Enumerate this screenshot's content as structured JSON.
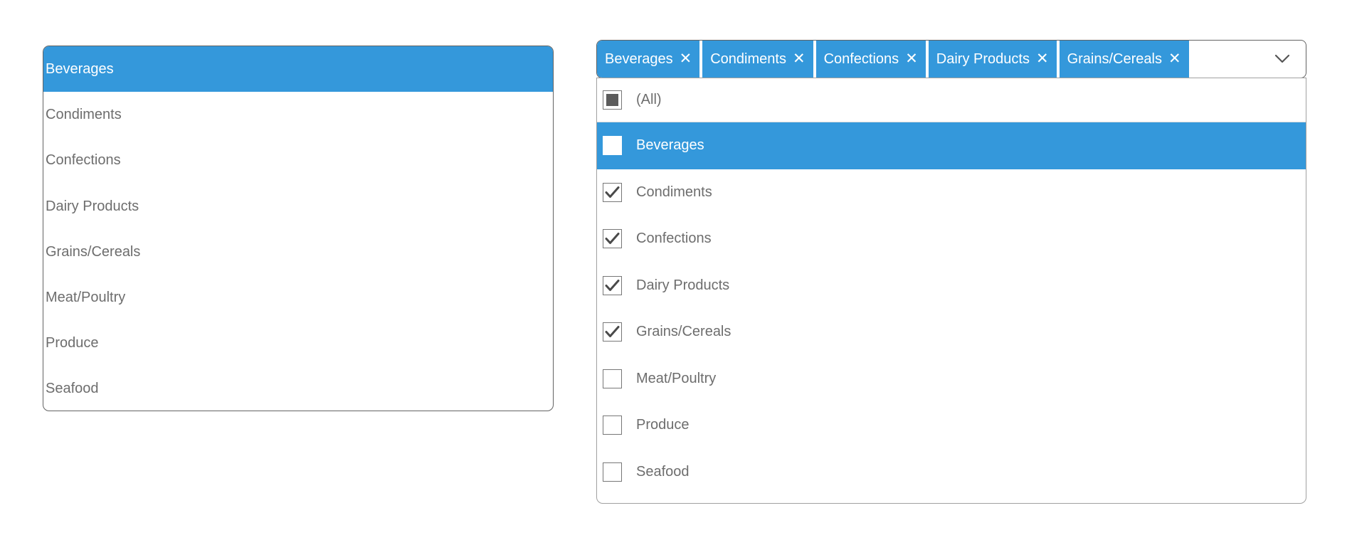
{
  "colors": {
    "accent": "#3498db",
    "text": "#6d6d6d",
    "border": "#636363",
    "panel_border": "#a0a0a0",
    "indeterminate_fill": "#5b5b5b",
    "white": "#ffffff"
  },
  "listbox": {
    "name": "category-listbox",
    "items": [
      {
        "label": "Beverages",
        "selected": true
      },
      {
        "label": "Condiments",
        "selected": false
      },
      {
        "label": "Confections",
        "selected": false
      },
      {
        "label": "Dairy Products",
        "selected": false
      },
      {
        "label": "Grains/Cereals",
        "selected": false
      },
      {
        "label": "Meat/Poultry",
        "selected": false
      },
      {
        "label": "Produce",
        "selected": false
      },
      {
        "label": "Seafood",
        "selected": false
      }
    ]
  },
  "multiselect": {
    "name": "category-multiselect",
    "chips": [
      {
        "label": "Beverages",
        "remove_icon": "close-icon",
        "remove_glyph": "✕"
      },
      {
        "label": "Condiments",
        "remove_icon": "close-icon",
        "remove_glyph": "✕"
      },
      {
        "label": "Confections",
        "remove_icon": "close-icon",
        "remove_glyph": "✕"
      },
      {
        "label": "Dairy Products",
        "remove_icon": "close-icon",
        "remove_glyph": "✕"
      },
      {
        "label": "Grains/Cereals",
        "remove_icon": "close-icon",
        "remove_glyph": "✕"
      }
    ],
    "toggle_icon": "chevron-down-icon",
    "options": [
      {
        "label": "(All)",
        "state": "indeterminate",
        "highlighted": false
      },
      {
        "label": "Beverages",
        "state": "checked",
        "highlighted": true
      },
      {
        "label": "Condiments",
        "state": "checked",
        "highlighted": false
      },
      {
        "label": "Confections",
        "state": "checked",
        "highlighted": false
      },
      {
        "label": "Dairy Products",
        "state": "checked",
        "highlighted": false
      },
      {
        "label": "Grains/Cereals",
        "state": "checked",
        "highlighted": false
      },
      {
        "label": "Meat/Poultry",
        "state": "unchecked",
        "highlighted": false
      },
      {
        "label": "Produce",
        "state": "unchecked",
        "highlighted": false
      },
      {
        "label": "Seafood",
        "state": "unchecked",
        "highlighted": false
      }
    ]
  }
}
